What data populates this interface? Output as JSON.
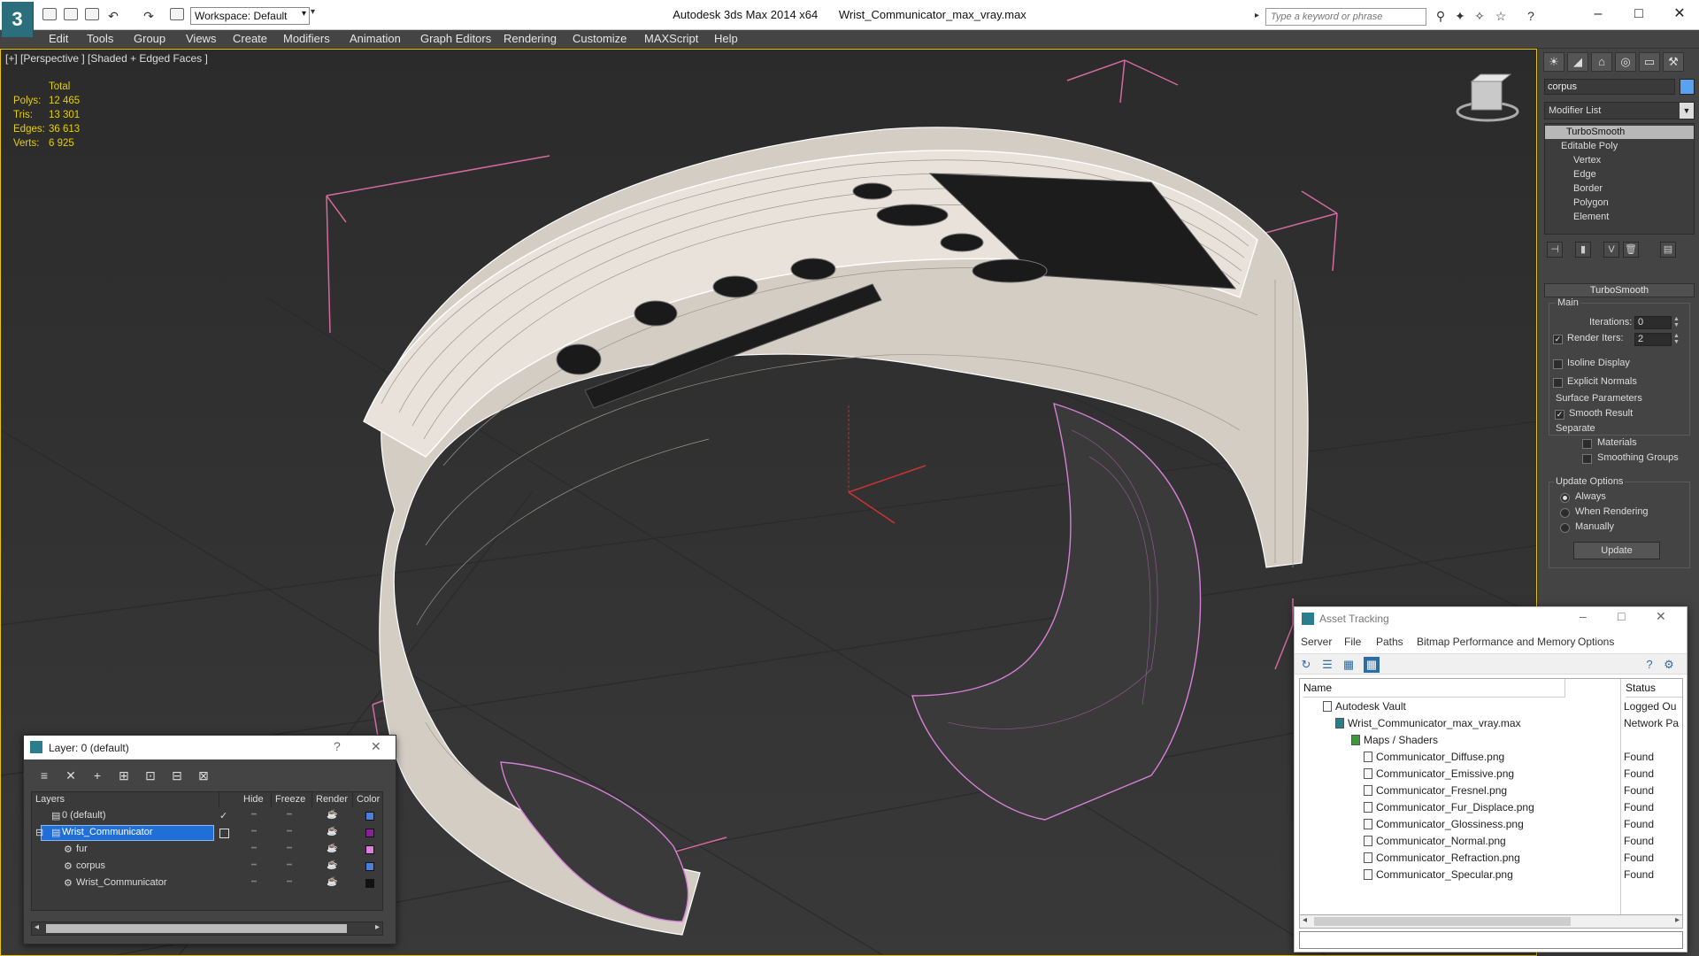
{
  "app": {
    "name": "Autodesk 3ds Max  2014 x64",
    "file": "Wrist_Communicator_max_vray.max",
    "workspace": "Workspace: Default",
    "search_placeholder": "Type a keyword or phrase"
  },
  "menu": [
    "Edit",
    "Tools",
    "Group",
    "Views",
    "Create",
    "Modifiers",
    "Animation",
    "Graph Editors",
    "Rendering",
    "Customize",
    "MAXScript",
    "Help"
  ],
  "viewport": {
    "label": "[+] [Perspective ] [Shaded + Edged Faces ]",
    "stats": {
      "total_label": "Total",
      "polys_label": "Polys:",
      "polys": "12 465",
      "tris_label": "Tris:",
      "tris": "13 301",
      "edges_label": "Edges:",
      "edges": "36 613",
      "verts_label": "Verts:",
      "verts": "6 925"
    }
  },
  "command_panel": {
    "object_name": "corpus",
    "object_color": "#5aa2f0",
    "modifier_list": "Modifier List",
    "stack": [
      "TurboSmooth",
      "Editable Poly",
      "Vertex",
      "Edge",
      "Border",
      "Polygon",
      "Element"
    ],
    "rollout_title": "TurboSmooth",
    "main_label": "Main",
    "iterations_label": "Iterations:",
    "iterations": "0",
    "render_iters_label": "Render Iters:",
    "render_iters": "2",
    "render_iters_checked": true,
    "isoline_label": "Isoline Display",
    "explicit_normals_label": "Explicit Normals",
    "surface_params_label": "Surface Parameters",
    "smooth_result_label": "Smooth Result",
    "separate_label": "Separate",
    "materials_label": "Materials",
    "smoothing_groups_label": "Smoothing Groups",
    "update_options_label": "Update Options",
    "update_always": "Always",
    "update_when_rendering": "When Rendering",
    "update_manually": "Manually",
    "update_button": "Update"
  },
  "layer_dialog": {
    "title": "Layer: 0 (default)",
    "help": "?",
    "columns": [
      "Layers",
      "Hide",
      "Freeze",
      "Render",
      "Color"
    ],
    "rows": [
      {
        "name": "0 (default)",
        "color": "#4a7fe0",
        "selected": false
      },
      {
        "name": "Wrist_Communicator",
        "color": "#8a1f9a",
        "selected": true
      },
      {
        "name": "fur",
        "color": "#e07ee0",
        "selected": false
      },
      {
        "name": "corpus",
        "color": "#4a7fe0",
        "selected": false
      },
      {
        "name": "Wrist_Communicator",
        "color": "#111111",
        "selected": false
      }
    ]
  },
  "asset_dialog": {
    "title": "Asset Tracking",
    "menu": [
      "Server",
      "File",
      "Paths",
      "Bitmap Performance and Memory",
      "Options"
    ],
    "columns": [
      "Name",
      "Status"
    ],
    "rows": [
      {
        "name": "Autodesk Vault",
        "status": "Logged Ou"
      },
      {
        "name": "Wrist_Communicator_max_vray.max",
        "status": "Network Pa"
      },
      {
        "name": "Maps / Shaders",
        "status": ""
      },
      {
        "name": "Communicator_Diffuse.png",
        "status": "Found"
      },
      {
        "name": "Communicator_Emissive.png",
        "status": "Found"
      },
      {
        "name": "Communicator_Fresnel.png",
        "status": "Found"
      },
      {
        "name": "Communicator_Fur_Displace.png",
        "status": "Found"
      },
      {
        "name": "Communicator_Glossiness.png",
        "status": "Found"
      },
      {
        "name": "Communicator_Normal.png",
        "status": "Found"
      },
      {
        "name": "Communicator_Refraction.png",
        "status": "Found"
      },
      {
        "name": "Communicator_Specular.png",
        "status": "Found"
      }
    ]
  }
}
